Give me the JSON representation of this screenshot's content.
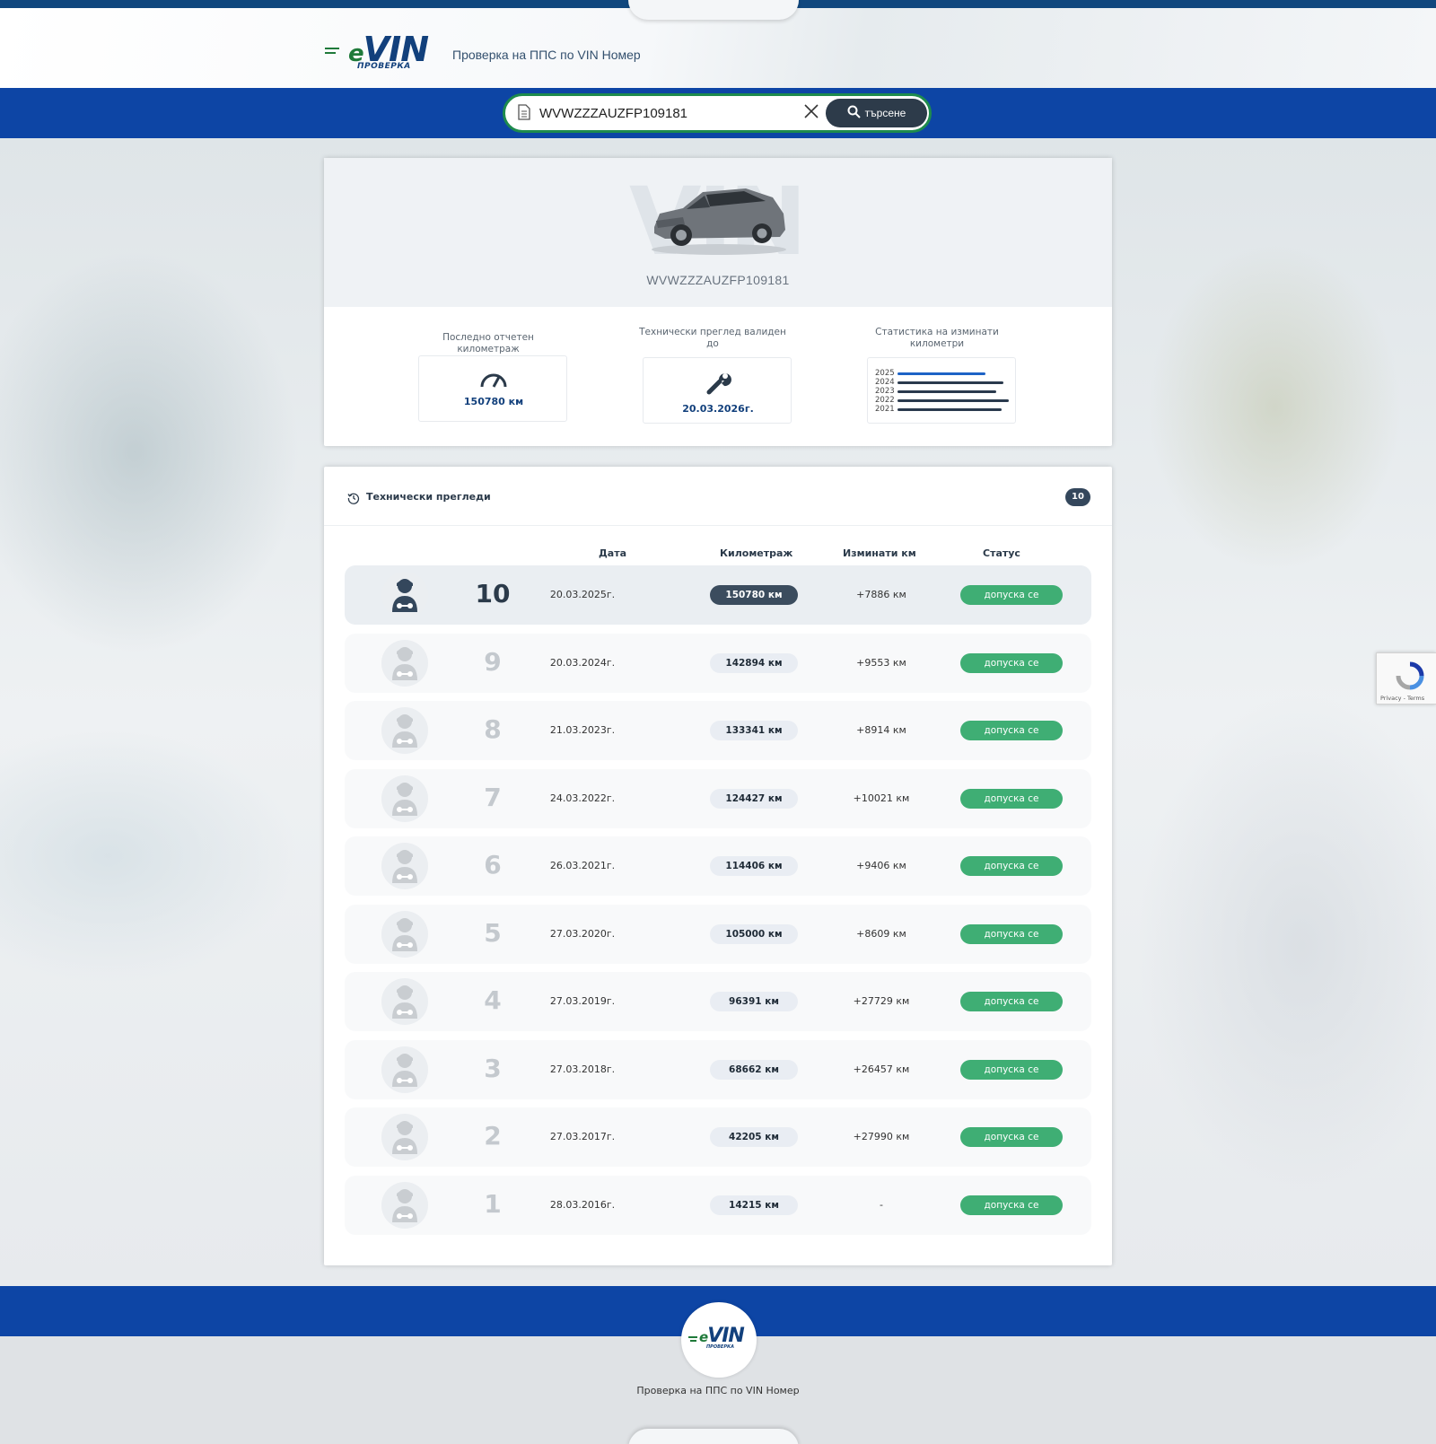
{
  "brand": {
    "logo_text": "VIN",
    "logo_e": "e",
    "logo_sub": "ПРОВЕРКА"
  },
  "header": {
    "title": "Проверка на ППС по VIN Номер"
  },
  "search": {
    "value": "WVWZZZAUZFP109181",
    "button_label": "търсене"
  },
  "vehicle": {
    "vin": "WVWZZZAUZFP109181",
    "hero_watermark": "VIN"
  },
  "stats": {
    "mileage": {
      "label": "Последно отчетен километраж",
      "value": "150780 км"
    },
    "inspection": {
      "label": "Технически преглед валиден до",
      "value": "20.03.2026г."
    },
    "chart": {
      "label": "Статистика на изминати километри",
      "years": [
        "2025",
        "2024",
        "2023",
        "2022",
        "2021"
      ],
      "km_travelled": [
        7886,
        9553,
        8914,
        10021,
        9406
      ]
    }
  },
  "inspections": {
    "title": "Технически прегледи",
    "count": "10",
    "columns": {
      "date": "Дата",
      "mileage": "Километраж",
      "travelled": "Изминати км",
      "status": "Статус"
    },
    "rows": [
      {
        "n": "10",
        "date": "20.03.2025г.",
        "km": "150780 км",
        "diff": "+7886 км",
        "status": "допуска се"
      },
      {
        "n": "9",
        "date": "20.03.2024г.",
        "km": "142894 км",
        "diff": "+9553 км",
        "status": "допуска се"
      },
      {
        "n": "8",
        "date": "21.03.2023г.",
        "km": "133341 км",
        "diff": "+8914 км",
        "status": "допуска се"
      },
      {
        "n": "7",
        "date": "24.03.2022г.",
        "km": "124427 км",
        "diff": "+10021 км",
        "status": "допуска се"
      },
      {
        "n": "6",
        "date": "26.03.2021г.",
        "km": "114406 км",
        "diff": "+9406 км",
        "status": "допуска се"
      },
      {
        "n": "5",
        "date": "27.03.2020г.",
        "km": "105000 км",
        "diff": "+8609 км",
        "status": "допуска се"
      },
      {
        "n": "4",
        "date": "27.03.2019г.",
        "km": "96391 км",
        "diff": "+27729 км",
        "status": "допуска се"
      },
      {
        "n": "3",
        "date": "27.03.2018г.",
        "km": "68662 км",
        "diff": "+26457 км",
        "status": "допуска се"
      },
      {
        "n": "2",
        "date": "27.03.2017г.",
        "km": "42205 км",
        "diff": "+27990 км",
        "status": "допуска се"
      },
      {
        "n": "1",
        "date": "28.03.2016г.",
        "km": "14215 км",
        "diff": "-",
        "status": "допуска се"
      }
    ]
  },
  "recaptcha": {
    "text": "Privacy - Terms"
  },
  "footer": {
    "title": "Проверка на ППС по VIN Номер"
  },
  "colors": {
    "blue_band": "#0d45a5",
    "status_green": "#3fae74",
    "dark_badge": "#34475c"
  }
}
